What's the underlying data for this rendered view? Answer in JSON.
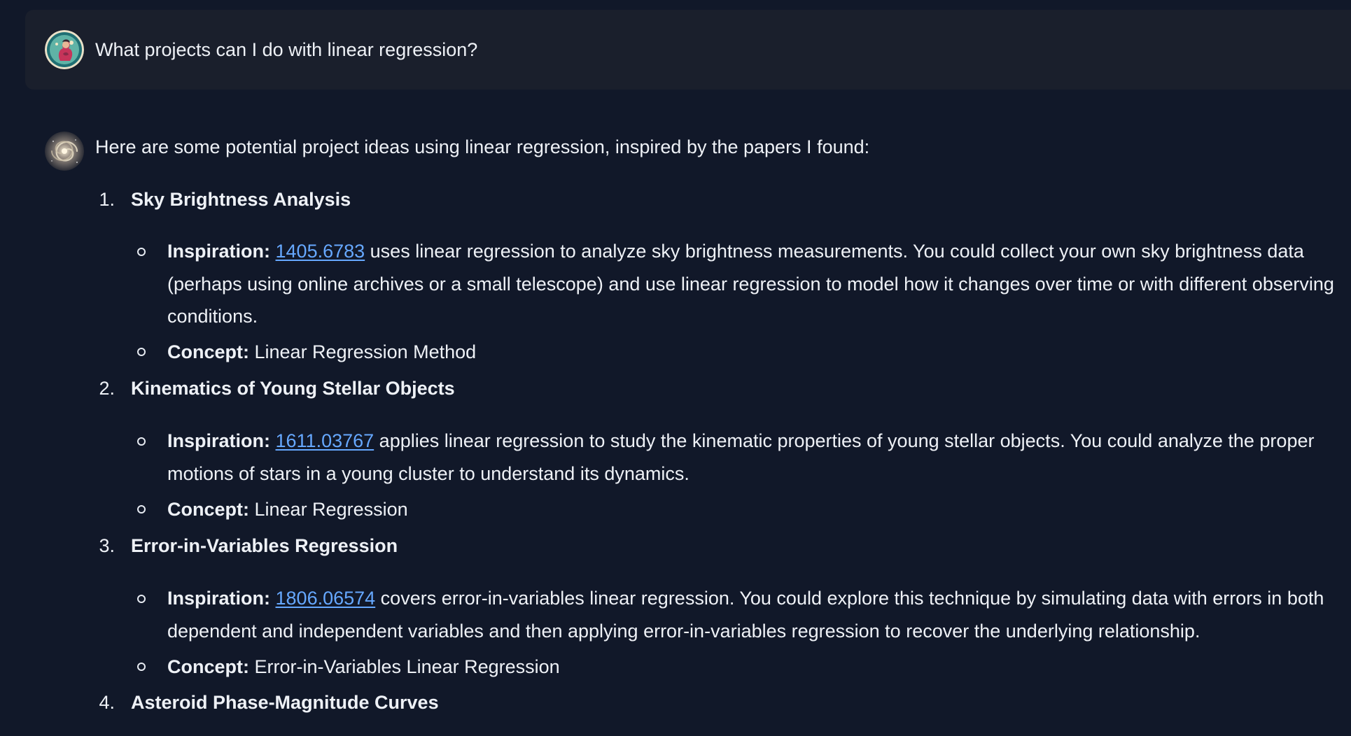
{
  "user_message": {
    "avatar_icon": "user-avatar-icon",
    "text": "What projects can I do with linear regression?"
  },
  "assistant_message": {
    "avatar_icon": "galaxy-avatar-icon",
    "intro": "Here are some potential project ideas using linear regression, inspired by the papers I found:",
    "projects": [
      {
        "number": "1.",
        "title": "Sky Brightness Analysis",
        "inspiration_label": "Inspiration:",
        "paper_id": "1405.6783",
        "inspiration_text": " uses linear regression to analyze sky brightness measurements. You could collect your own sky brightness data (perhaps using online archives or a small telescope) and use linear regression to model how it changes over time or with different observing conditions.",
        "concept_label": "Concept:",
        "concept_text": " Linear Regression Method"
      },
      {
        "number": "2.",
        "title": "Kinematics of Young Stellar Objects",
        "inspiration_label": "Inspiration:",
        "paper_id": "1611.03767",
        "inspiration_text": " applies linear regression to study the kinematic properties of young stellar objects. You could analyze the proper motions of stars in a young cluster to understand its dynamics.",
        "concept_label": "Concept:",
        "concept_text": " Linear Regression"
      },
      {
        "number": "3.",
        "title": "Error-in-Variables Regression",
        "inspiration_label": "Inspiration:",
        "paper_id": "1806.06574",
        "inspiration_text": " covers error-in-variables linear regression. You could explore this technique by simulating data with errors in both dependent and independent variables and then applying error-in-variables regression to recover the underlying relationship.",
        "concept_label": "Concept:",
        "concept_text": " Error-in-Variables Linear Regression"
      },
      {
        "number": "4.",
        "title": "Asteroid Phase-Magnitude Curves"
      }
    ]
  },
  "colors": {
    "background": "#111829",
    "user_bubble": "#1a1f2c",
    "text": "#eef1f6",
    "link": "#66a8ff"
  }
}
